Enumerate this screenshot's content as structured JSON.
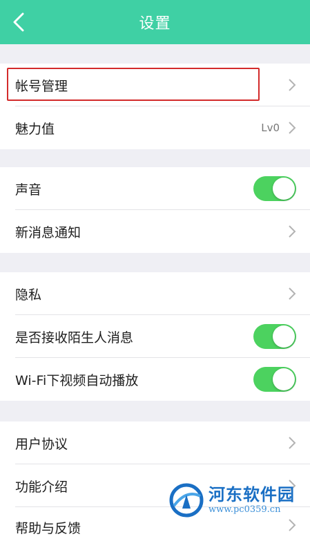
{
  "header": {
    "title": "设置",
    "back_icon": "chevron-left-icon"
  },
  "sections": [
    {
      "items": [
        {
          "label": "帐号管理",
          "control": "chevron",
          "highlighted": true
        },
        {
          "label": "魅力值",
          "value": "Lv0",
          "control": "chevron"
        }
      ]
    },
    {
      "items": [
        {
          "label": "声音",
          "control": "toggle",
          "on": true
        },
        {
          "label": "新消息通知",
          "control": "chevron"
        }
      ]
    },
    {
      "items": [
        {
          "label": "隐私",
          "control": "chevron"
        },
        {
          "label": "是否接收陌生人消息",
          "control": "toggle",
          "on": true
        },
        {
          "label": "Wi-Fi下视频自动播放",
          "control": "toggle",
          "on": true
        }
      ]
    },
    {
      "items": [
        {
          "label": "用户协议",
          "control": "chevron"
        },
        {
          "label": "功能介绍",
          "control": "chevron"
        },
        {
          "label": "帮助与反馈",
          "control": "chevron"
        }
      ]
    }
  ],
  "watermark": {
    "name": "河东软件园",
    "url": "www.pc0359.cn"
  },
  "colors": {
    "header": "#3fd0a4",
    "toggle_on": "#4cd25f",
    "highlight_box": "#d32a2a",
    "background": "#efeff4"
  }
}
